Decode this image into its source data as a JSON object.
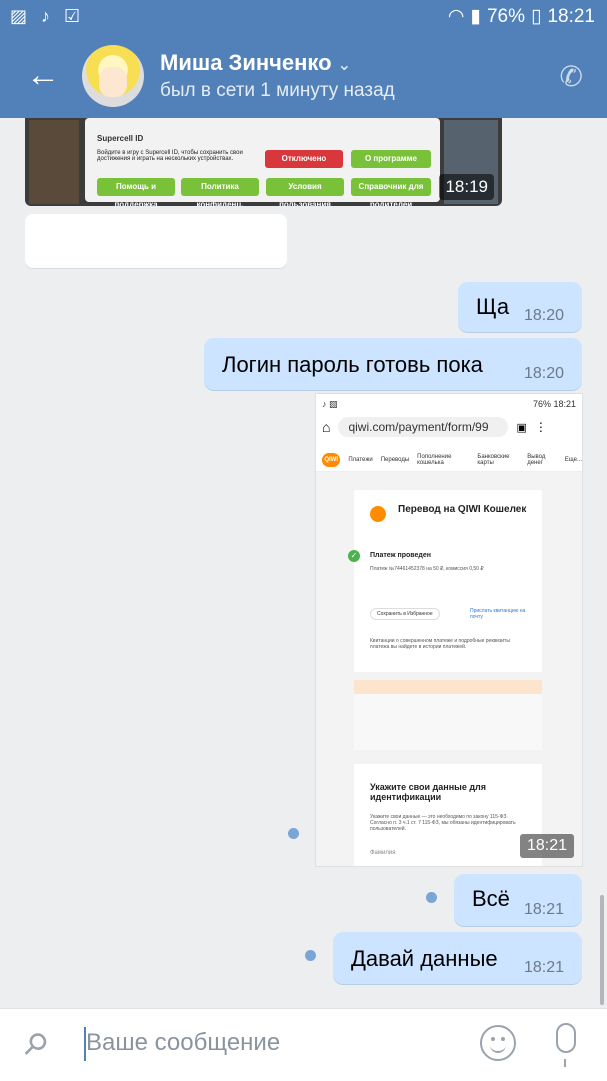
{
  "status_bar": {
    "battery": "76%",
    "time": "18:21"
  },
  "header": {
    "contact_name": "Миша Зинченко",
    "last_seen": "был в сети 1 минуту назад"
  },
  "messages": {
    "game_image": {
      "title": "Supercell ID",
      "text": "Войдите в игру с Supercell ID, чтобы сохранить свои достижения и играть на нескольких устройствах.",
      "buttons": [
        "Отключено",
        "О программе",
        "Помощь и поддержка",
        "Политика конфиденц.",
        "Условия пользования",
        "Справочник для родителей"
      ],
      "time": "18:19"
    },
    "out1": {
      "text": "Ща",
      "time": "18:20"
    },
    "out2": {
      "text": "Логин пароль готовь пока",
      "time": "18:20"
    },
    "screenshot": {
      "status": "76% 18:21",
      "url": "qiwi.com/payment/form/99",
      "nav_items": [
        "Платежи",
        "Переводы",
        "Пополнение кошелька",
        "Банковские карты",
        "Вывод денег",
        "Еще..."
      ],
      "logo": "QIWI",
      "card_title": "Перевод на QIWI Кошелек",
      "paid": "Платеж проведен",
      "paid_details": "Платеж №74461452378 на 50 ₽, комиссия 0,50 ₽",
      "save_fav": "Сохранить в Избранное",
      "receipt": "Прислать квитанцию на почту",
      "note": "Квитанции о совершенном платеже и подробные реквизиты платежа вы найдете в истории платежей.",
      "id_title": "Укажите свои данные для идентификации",
      "id_desc": "Укажите свои данные — это необходимо по закону 115-ФЗ. Согласно п. 3 ч.1 ст. 7 115-ФЗ, мы обязаны идентифицировать пользователей.",
      "field": "Фамилия",
      "time": "18:21"
    },
    "out3": {
      "text": "Всё",
      "time": "18:21"
    },
    "out4": {
      "text": "Давай данные",
      "time": "18:21"
    }
  },
  "input": {
    "placeholder": "Ваше сообщение"
  }
}
